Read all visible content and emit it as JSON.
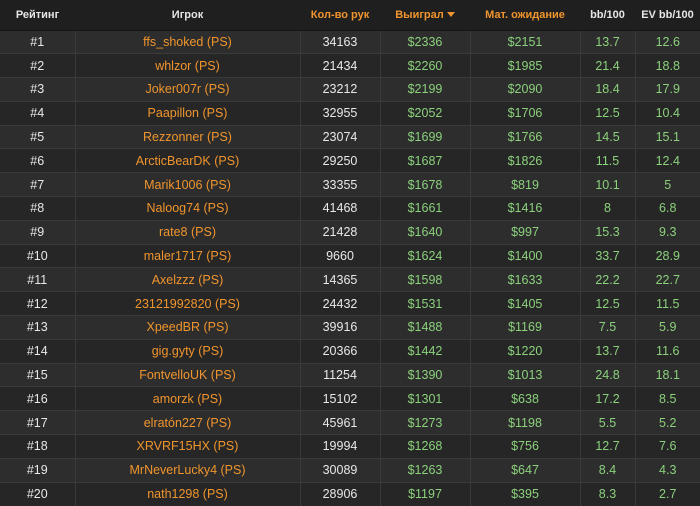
{
  "colors": {
    "background": "#2b2b2b",
    "header_background": "#1f1f1f",
    "accent_orange": "#f0952d",
    "positive_green": "#8bd17c",
    "text_light": "#e8e8e8"
  },
  "table": {
    "headers": {
      "rank": "Рейтинг",
      "player": "Игрок",
      "hands": "Кол-во рук",
      "won": "Выиграл",
      "ev": "Мат. ожидание",
      "bb100": "bb/100",
      "evbb100": "EV bb/100"
    },
    "sorted_by": "won",
    "sort_icon": "caret-down-icon",
    "rows": [
      {
        "rank": "#1",
        "player": "ffs_shoked (PS)",
        "hands": "34163",
        "won": "$2336",
        "ev": "$2151",
        "bb100": "13.7",
        "evbb100": "12.6"
      },
      {
        "rank": "#2",
        "player": "whlzor (PS)",
        "hands": "21434",
        "won": "$2260",
        "ev": "$1985",
        "bb100": "21.4",
        "evbb100": "18.8"
      },
      {
        "rank": "#3",
        "player": "Joker007r (PS)",
        "hands": "23212",
        "won": "$2199",
        "ev": "$2090",
        "bb100": "18.4",
        "evbb100": "17.9"
      },
      {
        "rank": "#4",
        "player": "Paapillon (PS)",
        "hands": "32955",
        "won": "$2052",
        "ev": "$1706",
        "bb100": "12.5",
        "evbb100": "10.4"
      },
      {
        "rank": "#5",
        "player": "Rezzonner (PS)",
        "hands": "23074",
        "won": "$1699",
        "ev": "$1766",
        "bb100": "14.5",
        "evbb100": "15.1"
      },
      {
        "rank": "#6",
        "player": "ArcticBearDK (PS)",
        "hands": "29250",
        "won": "$1687",
        "ev": "$1826",
        "bb100": "11.5",
        "evbb100": "12.4"
      },
      {
        "rank": "#7",
        "player": "Marik1006 (PS)",
        "hands": "33355",
        "won": "$1678",
        "ev": "$819",
        "bb100": "10.1",
        "evbb100": "5"
      },
      {
        "rank": "#8",
        "player": "Naloog74 (PS)",
        "hands": "41468",
        "won": "$1661",
        "ev": "$1416",
        "bb100": "8",
        "evbb100": "6.8"
      },
      {
        "rank": "#9",
        "player": "rate8 (PS)",
        "hands": "21428",
        "won": "$1640",
        "ev": "$997",
        "bb100": "15.3",
        "evbb100": "9.3"
      },
      {
        "rank": "#10",
        "player": "maler1717 (PS)",
        "hands": "9660",
        "won": "$1624",
        "ev": "$1400",
        "bb100": "33.7",
        "evbb100": "28.9"
      },
      {
        "rank": "#11",
        "player": "Axelzzz (PS)",
        "hands": "14365",
        "won": "$1598",
        "ev": "$1633",
        "bb100": "22.2",
        "evbb100": "22.7"
      },
      {
        "rank": "#12",
        "player": "23121992820 (PS)",
        "hands": "24432",
        "won": "$1531",
        "ev": "$1405",
        "bb100": "12.5",
        "evbb100": "11.5"
      },
      {
        "rank": "#13",
        "player": "XpeedBR (PS)",
        "hands": "39916",
        "won": "$1488",
        "ev": "$1169",
        "bb100": "7.5",
        "evbb100": "5.9"
      },
      {
        "rank": "#14",
        "player": "gig.gyty (PS)",
        "hands": "20366",
        "won": "$1442",
        "ev": "$1220",
        "bb100": "13.7",
        "evbb100": "11.6"
      },
      {
        "rank": "#15",
        "player": "FontvelloUK (PS)",
        "hands": "11254",
        "won": "$1390",
        "ev": "$1013",
        "bb100": "24.8",
        "evbb100": "18.1"
      },
      {
        "rank": "#16",
        "player": "amorzk (PS)",
        "hands": "15102",
        "won": "$1301",
        "ev": "$638",
        "bb100": "17.2",
        "evbb100": "8.5"
      },
      {
        "rank": "#17",
        "player": "elratón227 (PS)",
        "hands": "45961",
        "won": "$1273",
        "ev": "$1198",
        "bb100": "5.5",
        "evbb100": "5.2"
      },
      {
        "rank": "#18",
        "player": "XRVRF15HX (PS)",
        "hands": "19994",
        "won": "$1268",
        "ev": "$756",
        "bb100": "12.7",
        "evbb100": "7.6"
      },
      {
        "rank": "#19",
        "player": "MrNeverLucky4 (PS)",
        "hands": "30089",
        "won": "$1263",
        "ev": "$647",
        "bb100": "8.4",
        "evbb100": "4.3"
      },
      {
        "rank": "#20",
        "player": "nath1298 (PS)",
        "hands": "28906",
        "won": "$1197",
        "ev": "$395",
        "bb100": "8.3",
        "evbb100": "2.7"
      }
    ]
  }
}
